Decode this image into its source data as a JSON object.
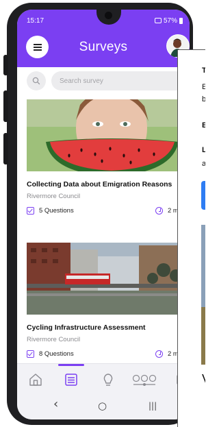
{
  "status_bar": {
    "time": "15:17",
    "battery": "57%"
  },
  "header": {
    "title": "Surveys"
  },
  "search": {
    "placeholder": "Search survey"
  },
  "surveys": [
    {
      "title": "Collecting Data about Emigration Reasons",
      "organization": "Rivermore Council",
      "questions": "5 Questions",
      "time": "2 m"
    },
    {
      "title": "Cycling Infrastructure Assessment",
      "organization": "Rivermore Council",
      "questions": "8 Questions",
      "time": "2 m"
    }
  ],
  "bottom_nav": {
    "items": [
      "home-icon",
      "surveys-list-icon",
      "lightbulb-icon",
      "options-slider-icon",
      "more-icon"
    ],
    "active_index": 1
  },
  "system_nav": {
    "back": "‹",
    "home": "○",
    "recents": "|||"
  },
  "overlay": {
    "lines": [
      "T",
      "E",
      "b",
      "E",
      "L",
      "a",
      "V"
    ]
  },
  "colors": {
    "accent": "#7b3ff2",
    "overlay_button": "#2e7df3"
  }
}
